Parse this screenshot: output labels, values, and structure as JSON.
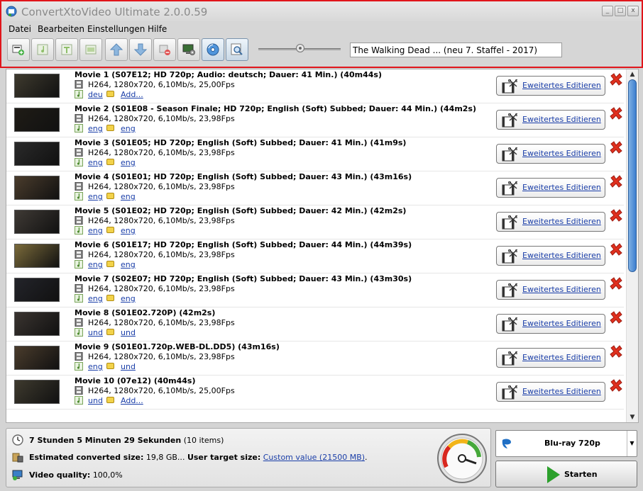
{
  "window": {
    "title": "ConvertXtoVideo Ultimate 2.0.0.59"
  },
  "menu": [
    "Datei",
    "Bearbeiten",
    "Einstellungen",
    "Hilfe"
  ],
  "search": {
    "value": "The Walking Dead ... (neu 7. Staffel - 2017)"
  },
  "list": {
    "edit_label": "Eweitertes Editieren",
    "items": [
      {
        "title": "Movie 1 (S07E12; HD 720p; Audio: deutsch; Dauer: 41 Min.) (40m44s)",
        "spec": "H264, 1280x720, 6,10Mb/s, 25,00Fps",
        "audio": "deu",
        "subtitle": "Add...",
        "thumb_color": "#3e3a2e"
      },
      {
        "title": "Movie 2 (S01E08 - Season Finale; HD 720p; English (Soft) Subbed; Dauer: 44 Min.) (44m2s)",
        "spec": "H264, 1280x720, 6,10Mb/s, 23,98Fps",
        "audio": "eng",
        "subtitle": "eng",
        "thumb_color": "#1f1c16"
      },
      {
        "title": "Movie 3 (S01E05; HD 720p; English (Soft) Subbed; Dauer: 41 Min.) (41m9s)",
        "spec": "H264, 1280x720, 6,10Mb/s, 23,98Fps",
        "audio": "eng",
        "subtitle": "eng",
        "thumb_color": "#2a2a2a"
      },
      {
        "title": "Movie 4 (S01E01; HD 720p; English (Soft) Subbed; Dauer: 43 Min.) (43m16s)",
        "spec": "H264, 1280x720, 6,10Mb/s, 23,98Fps",
        "audio": "eng",
        "subtitle": "eng",
        "thumb_color": "#4a3c2c"
      },
      {
        "title": "Movie 5 (S01E02; HD 720p; English (Soft) Subbed; Dauer: 42 Min.) (42m2s)",
        "spec": "H264, 1280x720, 6,10Mb/s, 23,98Fps",
        "audio": "eng",
        "subtitle": "eng",
        "thumb_color": "#3f3a35"
      },
      {
        "title": "Movie 6 (S01E17; HD 720p; English (Soft) Subbed; Dauer: 44 Min.) (44m39s)",
        "spec": "H264, 1280x720, 6,10Mb/s, 23,98Fps",
        "audio": "eng",
        "subtitle": "eng",
        "thumb_color": "#7a6a3a"
      },
      {
        "title": "Movie 7 (S02E07; HD 720p; English (Soft) Subbed; Dauer: 43 Min.) (43m30s)",
        "spec": "H264, 1280x720, 6,10Mb/s, 23,98Fps",
        "audio": "eng",
        "subtitle": "eng",
        "thumb_color": "#23242a"
      },
      {
        "title": "Movie 8 (S01E02.720P) (42m2s)",
        "spec": "H264, 1280x720, 6,10Mb/s, 23,98Fps",
        "audio": "und",
        "subtitle": "und",
        "thumb_color": "#3a3430"
      },
      {
        "title": "Movie 9 (S01E01.720p.WEB-DL.DD5) (43m16s)",
        "spec": "H264, 1280x720, 6,10Mb/s, 23,98Fps",
        "audio": "eng",
        "subtitle": "und",
        "thumb_color": "#4a3c2c"
      },
      {
        "title": "Movie 10 (07e12) (40m44s)",
        "spec": "H264, 1280x720, 6,10Mb/s, 25,00Fps",
        "audio": "und",
        "subtitle": "Add...",
        "thumb_color": "#3e3a2e"
      }
    ]
  },
  "status": {
    "duration": "7 Stunden 5 Minuten 29 Sekunden",
    "item_count": "(10 items)",
    "size_label": "Estimated converted size:",
    "size_value": "19,8 GB..",
    "target_label": "User target size:",
    "target_value": "Custom value (21500 MB)",
    "target_suffix": ".",
    "quality_label": "Video quality:",
    "quality_value": "100,0%"
  },
  "profile": {
    "label": "Blu-ray 720p"
  },
  "start": {
    "label": "Starten"
  },
  "colors": {
    "highlight_border": "#e0151b",
    "link": "#1a3ea8",
    "delete": "#e0301e",
    "start": "#2ca02c"
  }
}
